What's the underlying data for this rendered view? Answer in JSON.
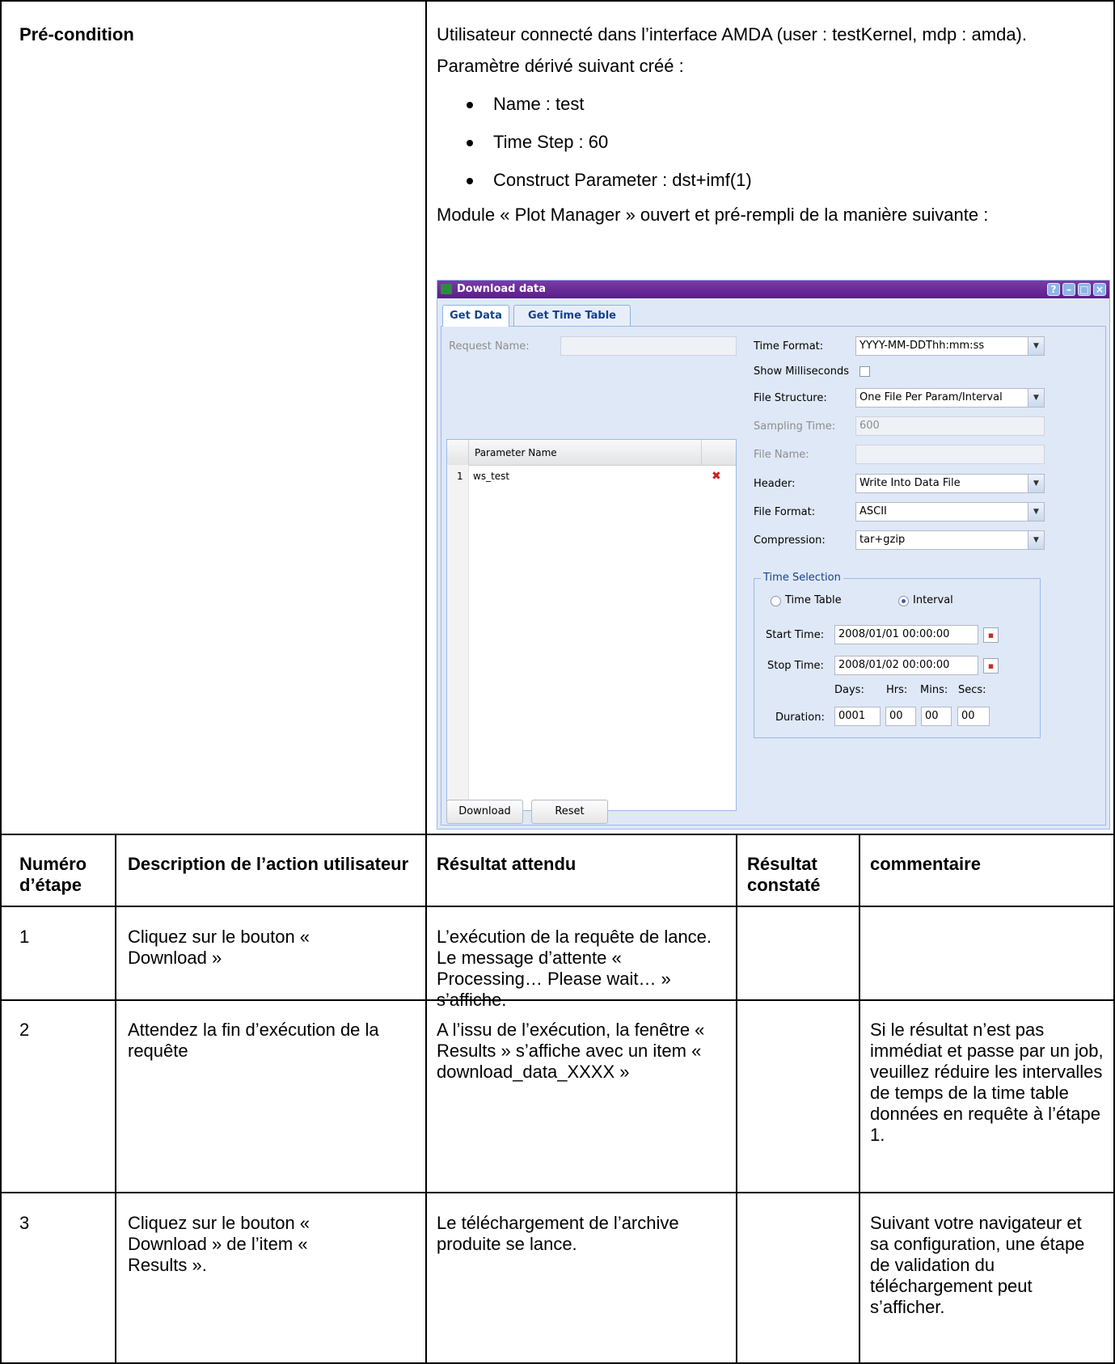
{
  "precondition": {
    "label": "Pré-condition",
    "line1": "Utilisateur connecté dans l’interface AMDA (user : testKernel, mdp : amda).",
    "line2": "Paramètre dérivé suivant créé :",
    "bullets": [
      "Name : test",
      "Time Step : 60",
      "Construct Parameter : dst+imf(1)"
    ],
    "line3": "Module « Plot Manager » ouvert et pré-rempli de la manière suivante :"
  },
  "window": {
    "title": "Download data",
    "title_buttons": [
      "?",
      "–",
      "□",
      "×"
    ],
    "tabs": [
      "Get Data",
      "Get Time Table"
    ],
    "request_name_label": "Request Name:",
    "request_name_value": "",
    "grid_header": "Parameter Name",
    "grid_rows": [
      {
        "num": "1",
        "name": "ws_test"
      }
    ],
    "remove_icon_glyph": "✖",
    "time_format_label": "Time Format:",
    "time_format_value": "YYYY-MM-DDThh:mm:ss",
    "show_ms_label": "Show Milliseconds",
    "file_structure_label": "File Structure:",
    "file_structure_value": "One File Per Param/Interval",
    "sampling_label": "Sampling Time:",
    "sampling_value": "600",
    "file_name_label": "File Name:",
    "file_name_value": "",
    "header_label": "Header:",
    "header_value": "Write Into Data File",
    "file_format_label": "File Format:",
    "file_format_value": "ASCII",
    "compression_label": "Compression:",
    "compression_value": "tar+gzip",
    "time_selection_legend": "Time Selection",
    "radio_timetable": "Time Table",
    "radio_interval": "Interval",
    "start_label": "Start Time:",
    "start_value": "2008/01/01 00:00:00",
    "stop_label": "Stop Time:",
    "stop_value": "2008/01/02 00:00:00",
    "days_label": "Days:",
    "hrs_label": "Hrs:",
    "mins_label": "Mins:",
    "secs_label": "Secs:",
    "duration_label": "Duration:",
    "duration_days": "0001",
    "duration_hrs": "00",
    "duration_mins": "00",
    "duration_secs": "00",
    "download_button": "Download",
    "reset_button": "Reset",
    "accent_color": "#6a2c99"
  },
  "table": {
    "headers": [
      "Numéro d’étape",
      "Description de l’action utilisateur",
      "Résultat attendu",
      "Résultat constaté",
      "commentaire"
    ],
    "rows": [
      {
        "num": "1",
        "action": "Cliquez sur le bouton « Download »",
        "expected": "L’exécution de la requête de lance. Le message d’attente « Processing… Please wait… » s’affiche.",
        "observed": "",
        "comment": ""
      },
      {
        "num": "2",
        "action": "Attendez la fin d’exécution de la requête",
        "expected": "A l’issu de l’exécution, la fenêtre « Results » s’affiche avec un item « download_data_XXXX »",
        "observed": "",
        "comment": "Si le résultat n’est pas immédiat et passe par un job, veuillez réduire les intervalles de temps de la time table données en requête à l’étape 1."
      },
      {
        "num": "3",
        "action": "Cliquez sur le bouton « Download » de l’item « Results ».",
        "expected": "Le téléchargement de l’archive produite se lance.",
        "observed": "",
        "comment": "Suivant votre navigateur et sa configuration, une étape de validation du téléchargement peut s’afficher."
      }
    ]
  }
}
